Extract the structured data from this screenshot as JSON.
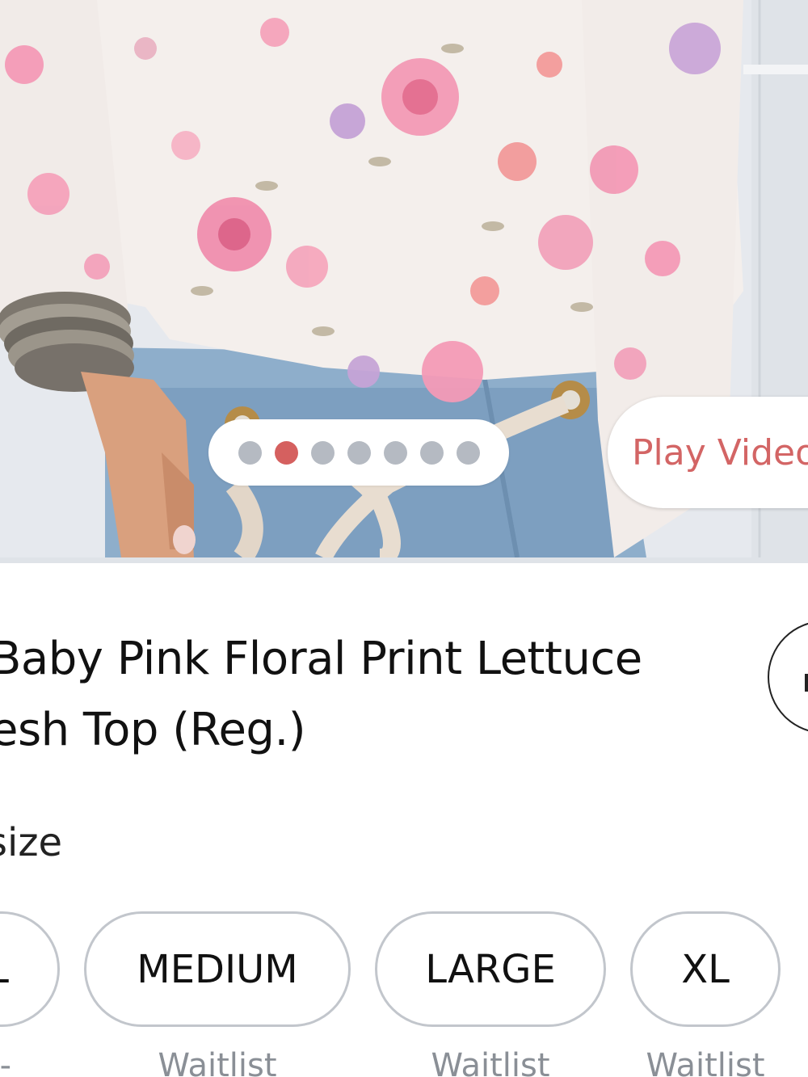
{
  "product": {
    "title_line1": "Baby Pink Floral Print Lettuce",
    "title_line2": "esh Top (Reg.)",
    "photo_alt": "product-photo"
  },
  "gallery": {
    "dot_count": 7,
    "active_index": 1,
    "play_video_label": "Play Video",
    "dot_color": "#b5bac2",
    "active_dot_color": "#d5605f"
  },
  "size": {
    "label": "size",
    "options": [
      {
        "label": "L",
        "status": "-"
      },
      {
        "label": "MEDIUM",
        "status": "Waitlist"
      },
      {
        "label": "LARGE",
        "status": "Waitlist"
      },
      {
        "label": "XL",
        "status": "Waitlist"
      }
    ]
  },
  "colors": {
    "accent": "#d36565",
    "chip_border": "#c2c6cc"
  }
}
